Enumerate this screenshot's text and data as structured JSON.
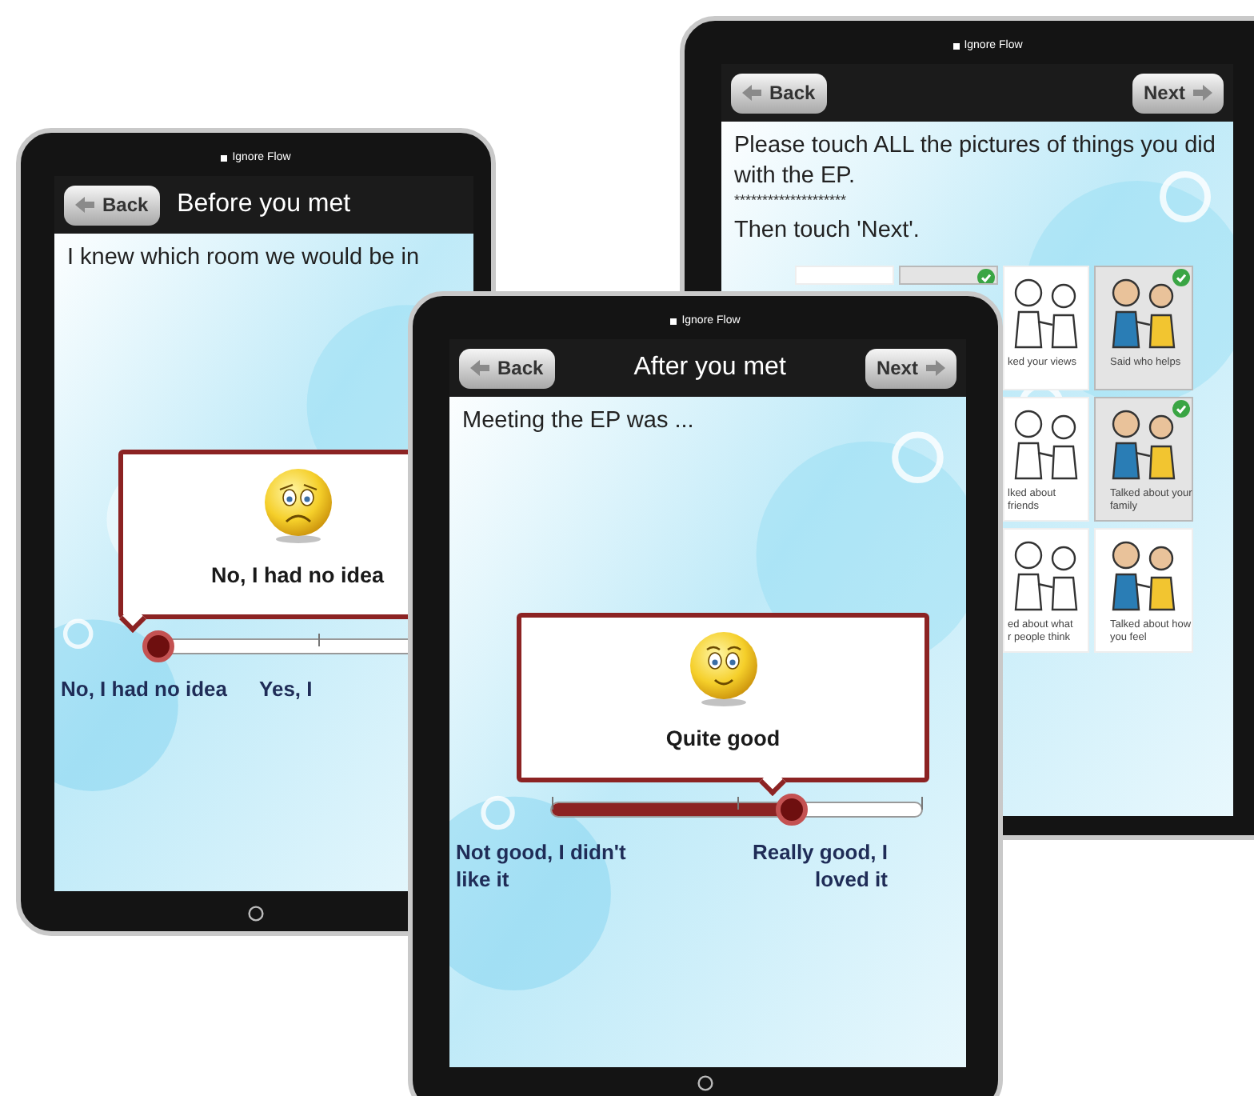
{
  "tablets": [
    {
      "kind": "picture_choice",
      "status_label": "Ignore Flow",
      "back_button": "Back",
      "next_button": "Next",
      "prompt": "Please touch ALL the pictures of things you did with the EP.",
      "separator": "********************",
      "instruction": "Then touch 'Next'.",
      "picture_rows": [
        [
          {
            "selected": false
          },
          {
            "selected": true
          },
          {
            "caption_lines": [
              "ked your views"
            ],
            "selected": false
          },
          {
            "caption_lines": [
              "Said who helps"
            ],
            "selected": true
          }
        ],
        [
          {
            "caption_lines": [
              "lked about",
              "friends"
            ],
            "selected": false
          },
          {
            "caption_lines": [
              "Talked about your",
              "family"
            ],
            "selected": true
          }
        ],
        [
          {
            "caption_lines": [
              "ed about what",
              "r people think"
            ],
            "selected": false
          },
          {
            "caption_lines": [
              "Talked about how",
              "you feel"
            ],
            "selected": false
          }
        ]
      ]
    },
    {
      "kind": "slider",
      "status_label": "Ignore Flow",
      "back_button": "Back",
      "title": "Before you met",
      "prompt": "I knew which room we would be in",
      "face": {
        "kind": "sad"
      },
      "callout": "No, I had no idea",
      "level": 0,
      "scale_labels": [
        "No, I had no idea",
        "Yes, I"
      ]
    },
    {
      "kind": "slider",
      "status_label": "Ignore Flow",
      "back_button": "Back",
      "title": "After you met",
      "next_button": "Next",
      "prompt": "Meeting the EP was ...",
      "face": {
        "kind": "happy"
      },
      "callout": "Quite good",
      "level": 0.65,
      "scale_labels": [
        "Not good, I didn't like it",
        "Really good, I loved it"
      ]
    }
  ]
}
